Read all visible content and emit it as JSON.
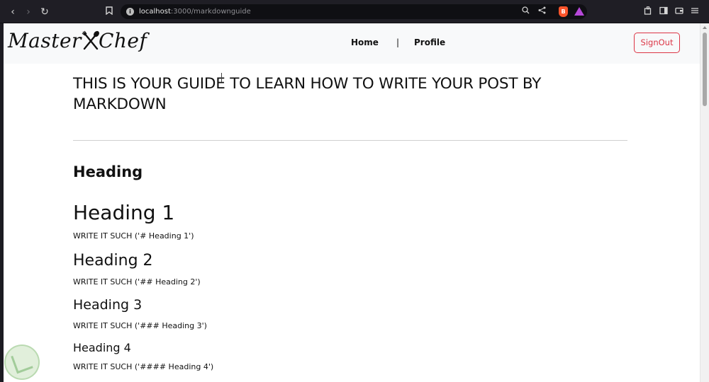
{
  "browser": {
    "url_host": "localhost",
    "url_path": ":3000/markdownguide",
    "icons": [
      "back-icon",
      "forward-icon",
      "reload-icon",
      "bookmark-icon",
      "info-icon",
      "zoom-icon",
      "share-icon",
      "brave-shields-icon",
      "brave-rewards-icon",
      "extensions-icon",
      "sidebar-icon",
      "wallet-icon",
      "menu-icon"
    ]
  },
  "navbar": {
    "logo_left": "Master",
    "logo_right": "Chef",
    "links": {
      "home": "Home",
      "separator": "|",
      "profile": "Profile"
    },
    "signout": "SignOut"
  },
  "content": {
    "title": "THIS IS YOUR GUIDE TO LEARN HOW TO WRITE YOUR POST BY MARKDOWN",
    "section_heading": "Heading",
    "examples": [
      {
        "heading": "Heading 1",
        "syntax": "WRITE IT SUCH ('# Heading 1')"
      },
      {
        "heading": "Heading 2",
        "syntax": "WRITE IT SUCH ('## Heading 2')"
      },
      {
        "heading": "Heading 3",
        "syntax": "WRITE IT SUCH ('### Heading 3')"
      },
      {
        "heading": "Heading 4",
        "syntax": "WRITE IT SUCH ('#### Heading 4')"
      }
    ]
  },
  "colors": {
    "accent_danger": "#dc3545",
    "navbar_bg": "#f8f9fa",
    "chrome_bg": "#1f1e25"
  }
}
